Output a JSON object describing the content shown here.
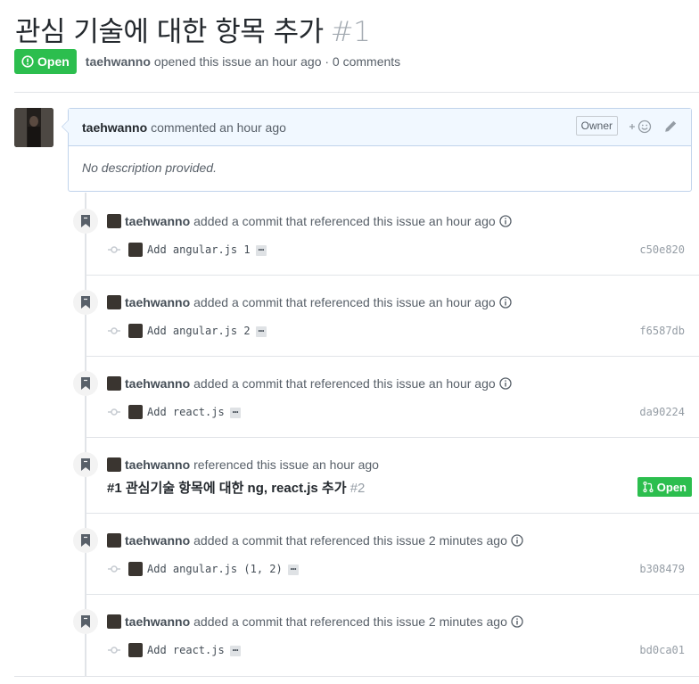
{
  "issue": {
    "title": "관심 기술에 대한 항목 추가",
    "number": "#1",
    "state": "Open",
    "author": "taehwanno",
    "opened_text": "opened this issue an hour ago · 0 comments"
  },
  "comment": {
    "author": "taehwanno",
    "action": "commented an hour ago",
    "owner_label": "Owner",
    "body": "No description provided."
  },
  "events": [
    {
      "author": "taehwanno",
      "text": "added a commit that referenced this issue an hour ago",
      "commit_message": "Add angular.js 1",
      "ellipsis": "…",
      "sha": "c50e820"
    },
    {
      "author": "taehwanno",
      "text": "added a commit that referenced this issue an hour ago",
      "commit_message": "Add angular.js 2",
      "ellipsis": "…",
      "sha": "f6587db"
    },
    {
      "author": "taehwanno",
      "text": "added a commit that referenced this issue an hour ago",
      "commit_message": "Add react.js",
      "ellipsis": "…",
      "sha": "da90224"
    },
    {
      "author": "taehwanno",
      "text": "referenced this issue an hour ago",
      "ref_title": "#1 관심기술 항목에 대한 ng, react.js 추가",
      "ref_number": "#2",
      "ref_state": "Open"
    },
    {
      "author": "taehwanno",
      "text": "added a commit that referenced this issue 2 minutes ago",
      "commit_message": "Add angular.js (1, 2)",
      "ellipsis": "…",
      "sha": "b308479"
    },
    {
      "author": "taehwanno",
      "text": "added a commit that referenced this issue 2 minutes ago",
      "commit_message": "Add react.js",
      "ellipsis": "…",
      "sha": "bd0ca01"
    }
  ],
  "icons": {
    "state": "issue-opened-icon",
    "event": "bookmark-icon",
    "info": "info-icon",
    "commit": "git-commit-icon",
    "pr": "git-pull-request-icon",
    "reaction": "smiley-icon",
    "edit": "pencil-icon"
  },
  "colors": {
    "open_green": "#2cbe4e",
    "comment_header_bg": "#f1f8ff",
    "comment_border": "#c0d3eb",
    "muted_text": "#586069"
  }
}
